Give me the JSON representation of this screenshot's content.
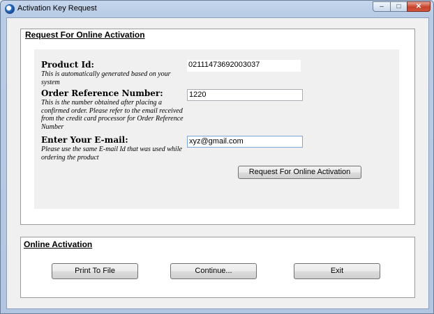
{
  "window": {
    "title": "Activation Key Request",
    "controls": {
      "minimize": "–",
      "maximize": "□",
      "close": "✕"
    },
    "app_icon": "app-icon"
  },
  "request_group": {
    "title": "Request For Online Activation",
    "product_id": {
      "label": "Product Id:",
      "hint": "This is automatically generated based on your system",
      "value": "02111473692003037"
    },
    "order_ref": {
      "label": "Order Reference Number:",
      "hint": "This is the number obtained after placing a confirmed order. Please refer to the email received from the credit card processor for Order Reference Number",
      "value": "1220"
    },
    "email": {
      "label": "Enter Your E-mail:",
      "hint": "Please use the same E-mail Id that was used while ordering the product",
      "value": "xyz@gmail.com"
    },
    "submit_label": "Request For Online Activation"
  },
  "online_group": {
    "title": "Online Activation",
    "print_label": "Print To File",
    "continue_label": "Continue...",
    "exit_label": "Exit"
  }
}
